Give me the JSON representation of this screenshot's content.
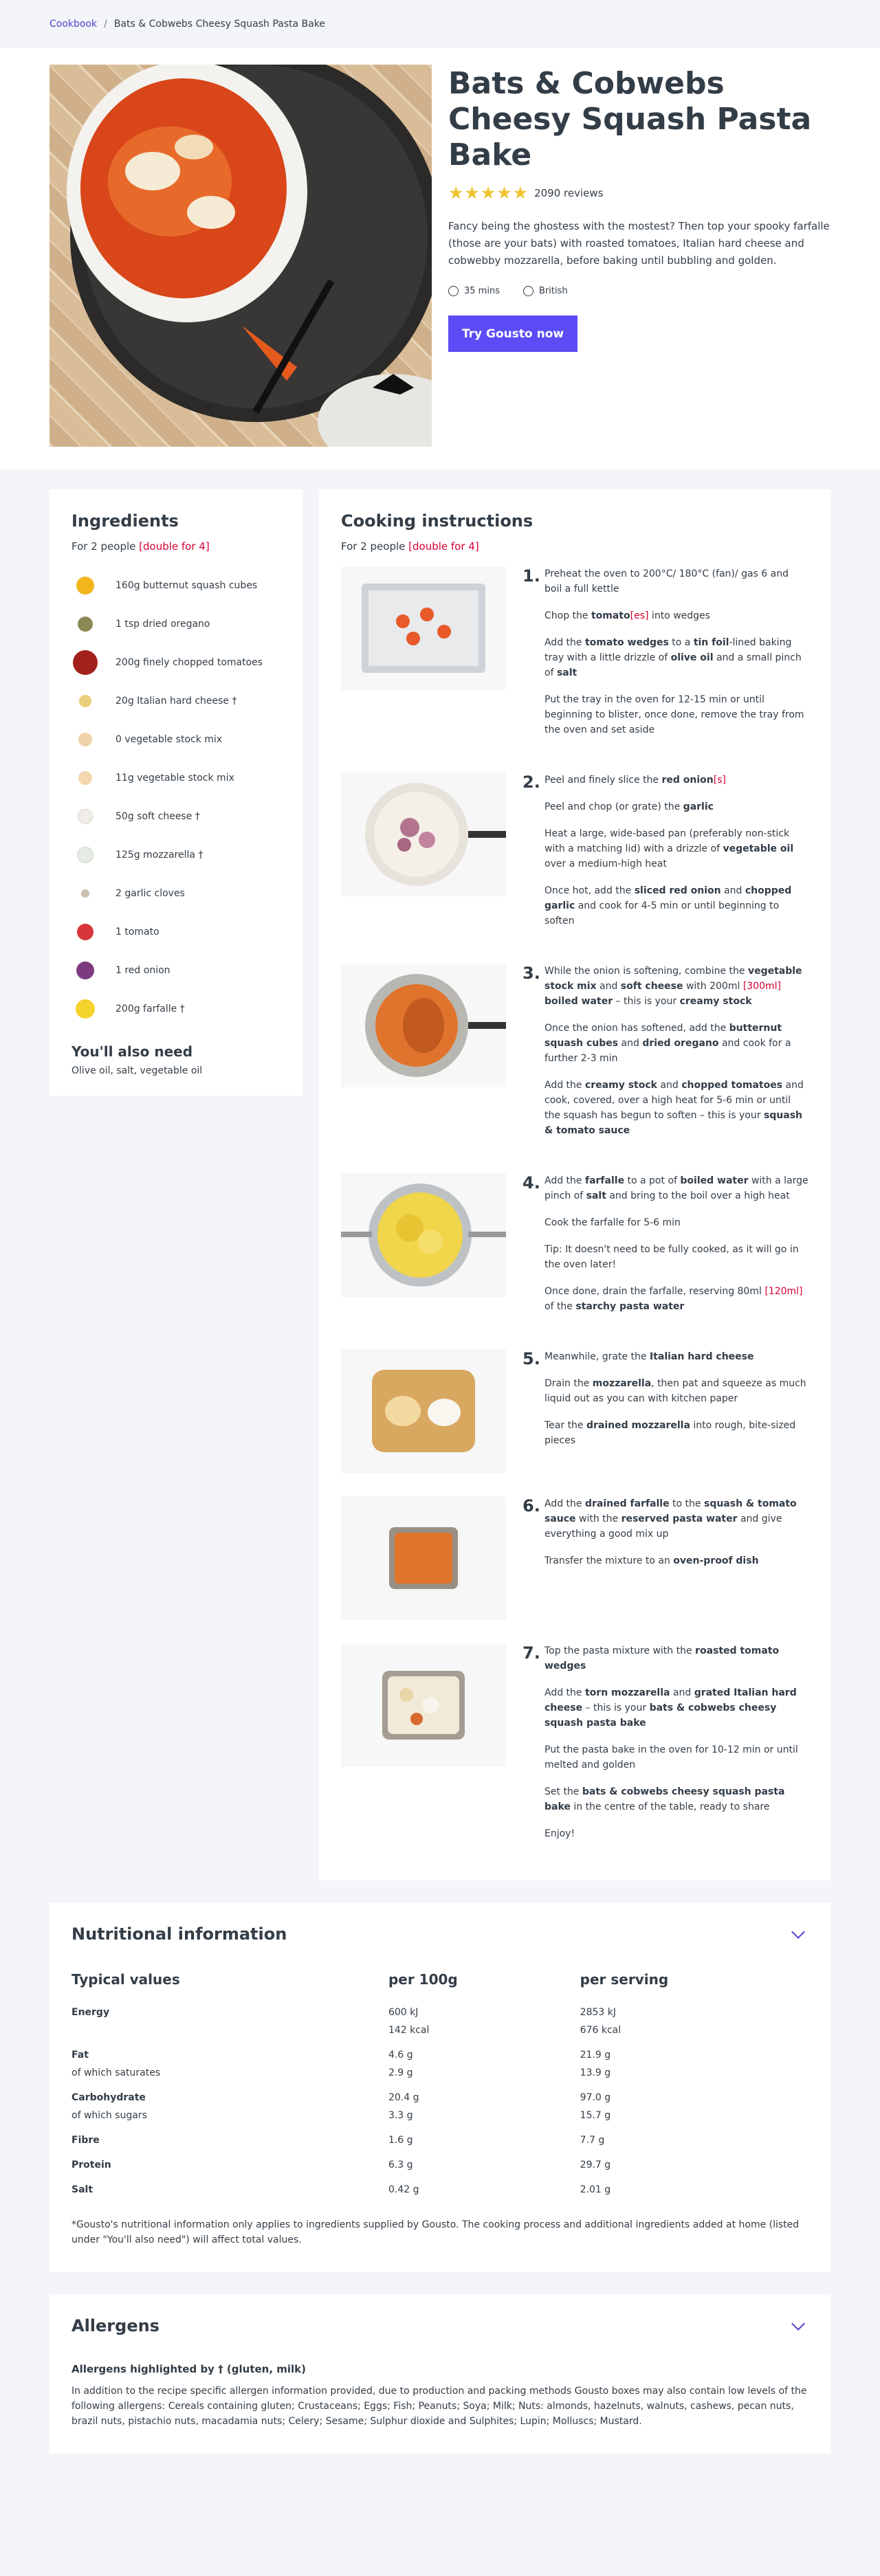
{
  "breadcrumb": {
    "root": "Cookbook",
    "sep": "/",
    "current": "Bats & Cobwebs Cheesy Squash Pasta Bake"
  },
  "recipe": {
    "title": "Bats & Cobwebs Cheesy Squash Pasta Bake",
    "stars": "★★★★★",
    "reviews": "2090 reviews",
    "description": "Fancy being the ghostess with the mostest? Then top your spooky farfalle (those are your bats) with roasted tomatoes, Italian hard cheese and cobwebby mozzarella, before baking until bubbling and golden.",
    "time": "35 mins",
    "cuisine": "British",
    "cta": "Try Gousto now"
  },
  "ingredients": {
    "title": "Ingredients",
    "for": "For 2 people",
    "double": "[double for 4]",
    "items": [
      {
        "label": "160g butternut squash cubes",
        "color": "#f2b51c"
      },
      {
        "label": "1 tsp dried oregano",
        "color": "#8b8a55"
      },
      {
        "label": "200g finely chopped tomatoes",
        "color": "#a3211c"
      },
      {
        "label": "20g Italian hard cheese †",
        "color": "#e9cf7a"
      },
      {
        "label": "0 vegetable stock mix",
        "color": "#efd2a8"
      },
      {
        "label": "11g vegetable stock mix",
        "color": "#f3d7ae"
      },
      {
        "label": "50g soft cheese †",
        "color": "#f0ede6"
      },
      {
        "label": "125g mozzarella †",
        "color": "#e4ebe2"
      },
      {
        "label": "2 garlic cloves",
        "color": "#c9bfae"
      },
      {
        "label": "1 tomato",
        "color": "#d8353a"
      },
      {
        "label": "1 red onion",
        "color": "#7d3a7f"
      },
      {
        "label": "200g farfalle †",
        "color": "#f6d22c"
      }
    ],
    "also_title": "You'll also need",
    "also_text": "Olive oil, salt, vegetable oil"
  },
  "cooking": {
    "title": "Cooking instructions",
    "for": "For 2 people",
    "double": "[double for 4]",
    "steps": [
      {
        "num": "1.",
        "paras": [
          "Preheat the oven to 200°C/ 180°C (fan)/ gas 6 and boil a full kettle",
          "Chop the <b>tomato</b><span class=\"red\">[es]</span> into wedges",
          "Add the <b>tomato wedges</b> to a <b>tin foil</b>-lined baking tray with a little drizzle of <b>olive oil</b> and a small pinch of <b>salt</b>",
          "Put the tray in the oven for 12-15 min or until beginning to blister, once done, remove the tray from the oven and set aside"
        ]
      },
      {
        "num": "2.",
        "paras": [
          "Peel and finely slice the <b>red onion</b><span class=\"red\">[s]</span>",
          "Peel and chop (or grate) the <b>garlic</b>",
          "Heat a large, wide-based pan (preferably non-stick with a matching lid) with a drizzle of <b>vegetable oil</b> over a medium-high heat",
          "Once hot, add the <b>sliced red onion</b> and <b>chopped garlic</b> and cook for 4-5 min or until beginning to soften"
        ]
      },
      {
        "num": "3.",
        "paras": [
          "While the onion is softening, combine the <b>vegetable stock mix</b> and <b>soft cheese</b> with 200ml <span class=\"red\">[300ml]</span> <b>boiled water</b> – this is your <b>creamy stock</b>",
          "Once the onion has softened, add the <b>butternut squash cubes</b> and <b>dried oregano</b> and cook for a further 2-3 min",
          "Add the <b>creamy stock</b> and <b>chopped tomatoes</b> and cook, covered, over a high heat for 5-6 min or until the squash has begun to soften – this is your <b>squash &amp; tomato sauce</b>"
        ]
      },
      {
        "num": "4.",
        "paras": [
          "Add the <b>farfalle</b> to a pot of <b>boiled water</b> with a large pinch of <b>salt</b> and bring to the boil over a high heat",
          "Cook the farfalle for 5-6 min",
          "Tip: It doesn't need to be fully cooked, as it will go in the oven later!",
          "Once done, drain the farfalle, reserving 80ml <span class=\"red\">[120ml]</span> of the <b>starchy pasta water</b>"
        ]
      },
      {
        "num": "5.",
        "paras": [
          "Meanwhile, grate the <b>Italian hard cheese</b>",
          "Drain the <b>mozzarella</b>, then pat and squeeze as much liquid out as you can with kitchen paper",
          "Tear the <b>drained mozzarella</b> into rough, bite-sized pieces"
        ]
      },
      {
        "num": "6.",
        "paras": [
          "Add the <b>drained farfalle</b> to the <b>squash &amp; tomato sauce</b> with the <b>reserved pasta water</b> and give everything a good mix up",
          "Transfer the mixture to an <b>oven-proof dish</b>"
        ]
      },
      {
        "num": "7.",
        "paras": [
          "Top the pasta mixture with the <b>roasted tomato wedges</b>",
          "Add the <b>torn mozzarella</b> and <b>grated Italian hard cheese</b> – this is your <b>bats &amp; cobwebs cheesy squash pasta bake</b>",
          "Put the pasta bake in the oven for 10-12 min or until melted and golden",
          "Set the <b>bats &amp; cobwebs cheesy squash pasta bake</b> in the centre of the table, ready to share",
          "Enjoy!"
        ]
      }
    ]
  },
  "nutrition": {
    "title": "Nutritional information",
    "headers": [
      "Typical values",
      "per 100g",
      "per serving"
    ],
    "rows": [
      {
        "label": "Energy",
        "bold": true,
        "per100": "600 kJ",
        "serving": "2853 kJ"
      },
      {
        "label": "",
        "bold": false,
        "per100": "142 kcal",
        "serving": "676 kcal"
      },
      {
        "label": "Fat",
        "bold": true,
        "per100": "4.6 g",
        "serving": "21.9 g"
      },
      {
        "label": "of which saturates",
        "bold": false,
        "per100": "2.9 g",
        "serving": "13.9 g"
      },
      {
        "label": "Carbohydrate",
        "bold": true,
        "per100": "20.4 g",
        "serving": "97.0 g"
      },
      {
        "label": "of which sugars",
        "bold": false,
        "per100": "3.3 g",
        "serving": "15.7 g"
      },
      {
        "label": "Fibre",
        "bold": true,
        "per100": "1.6 g",
        "serving": "7.7 g"
      },
      {
        "label": "Protein",
        "bold": true,
        "per100": "6.3 g",
        "serving": "29.7 g"
      },
      {
        "label": "Salt",
        "bold": true,
        "per100": "0.42 g",
        "serving": "2.01 g"
      }
    ],
    "note": "*Gousto's nutritional information only applies to ingredients supplied by Gousto. The cooking process and additional ingredients added at home (listed under \"You'll also need\") will affect total values."
  },
  "allergens": {
    "title": "Allergens",
    "highlight": "Allergens highlighted by † (gluten, milk)",
    "text": "In addition to the recipe specific allergen information provided, due to production and packing methods Gousto boxes may also contain low levels of the following allergens: Cereals containing gluten; Crustaceans; Eggs; Fish; Peanuts; Soya; Milk; Nuts: almonds, hazelnuts, walnuts, cashews, pecan nuts, brazil nuts, pistachio nuts, macadamia nuts; Celery; Sesame; Sulphur dioxide and Sulphites; Lupin; Molluscs; Mustard."
  }
}
